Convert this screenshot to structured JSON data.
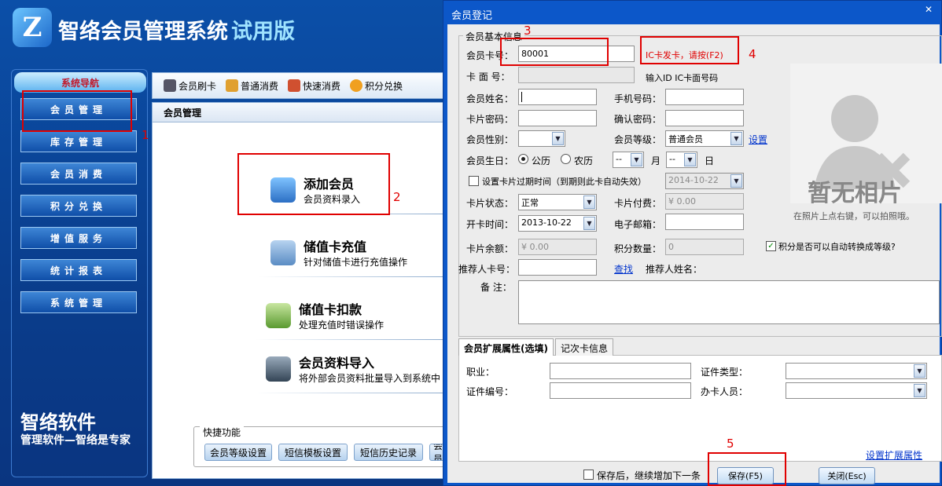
{
  "app": {
    "title": "智络会员管理系统",
    "edition": "试用版",
    "nav_header": "系统导航",
    "nav_items": [
      "会员管理",
      "库存管理",
      "会员消费",
      "积分兑换",
      "增值服务",
      "统计报表",
      "系统管理"
    ],
    "brand": "智络软件",
    "brand_tagline": "管理软件—智络是专家",
    "toolbar": [
      "会员刷卡",
      "普通消费",
      "快速消费",
      "积分兑换"
    ],
    "panel_title": "会员管理",
    "functions": [
      {
        "title": "添加会员",
        "desc": "会员资料录入"
      },
      {
        "title": "储值卡充值",
        "desc": "针对储值卡进行充值操作"
      },
      {
        "title": "储值卡扣款",
        "desc": "处理充值时错误操作"
      },
      {
        "title": "会员资料导入",
        "desc": "将外部会员资料批量导入到系统中"
      }
    ],
    "quick_label": "快捷功能",
    "quick_buttons": [
      "会员等级设置",
      "短信模板设置",
      "短信历史记录",
      "会员"
    ]
  },
  "dialog": {
    "title": "会员登记",
    "close": "✕",
    "group_label": "会员基本信息",
    "card_no_label": "会员卡号：",
    "card_no_value": "80001",
    "ic_hint": "IC卡发卡，请按(F2)",
    "face_label": "卡 面 号：",
    "face_hint": "输入ID IC卡面号码",
    "name_label": "会员姓名：",
    "phone_label": "手机号码：",
    "pwd_label": "卡片密码：",
    "pwd2_label": "确认密码：",
    "gender_label": "会员性别：",
    "level_label": "会员等级：",
    "level_value": "普通会员",
    "level_link": "设置",
    "birthday_label": "会员生日：",
    "solar": "公历",
    "lunar": "农历",
    "month_value": "--",
    "month_unit": "月",
    "day_value": "--",
    "day_unit": "日",
    "expire_label": "设置卡片过期时间（到期则此卡自动失效）",
    "expire_value": "2014-10-22",
    "status_label": "卡片状态：",
    "status_value": "正常",
    "fee_label": "卡片付费：",
    "fee_value": "¥ 0.00",
    "open_label": "开卡时间：",
    "open_value": "2013-10-22",
    "email_label": "电子邮箱：",
    "balance_label": "卡片余额：",
    "balance_value": "¥ 0.00",
    "points_label": "积分数量：",
    "points_value": "0",
    "auto_upgrade_label": "积分是否可以自动转换成等级?",
    "referrer_label": "推荐人卡号：",
    "referrer_link": "查找",
    "referrer_name_label": "推荐人姓名：",
    "remark_label": "备 注：",
    "photo_text": "暂无相片",
    "photo_hint": "在照片上点右键，可以拍照哦。",
    "tab_ext": "会员扩展属性(选填)",
    "tab_count": "记次卡信息",
    "job_label": "职业：",
    "idtype_label": "证件类型：",
    "idno_label": "证件编号：",
    "staff_label": "办卡人员：",
    "ext_link": "设置扩展属性",
    "continue_label": "保存后，继续增加下一条",
    "save_button": "保存(F5)",
    "close_button": "关闭(Esc)"
  },
  "annotations": [
    "1",
    "2",
    "3",
    "4",
    "5"
  ],
  "colors": {
    "nav_bg": "#0a3d8c",
    "dialog_title": "#0c57c9",
    "annotation": "#e00000"
  }
}
